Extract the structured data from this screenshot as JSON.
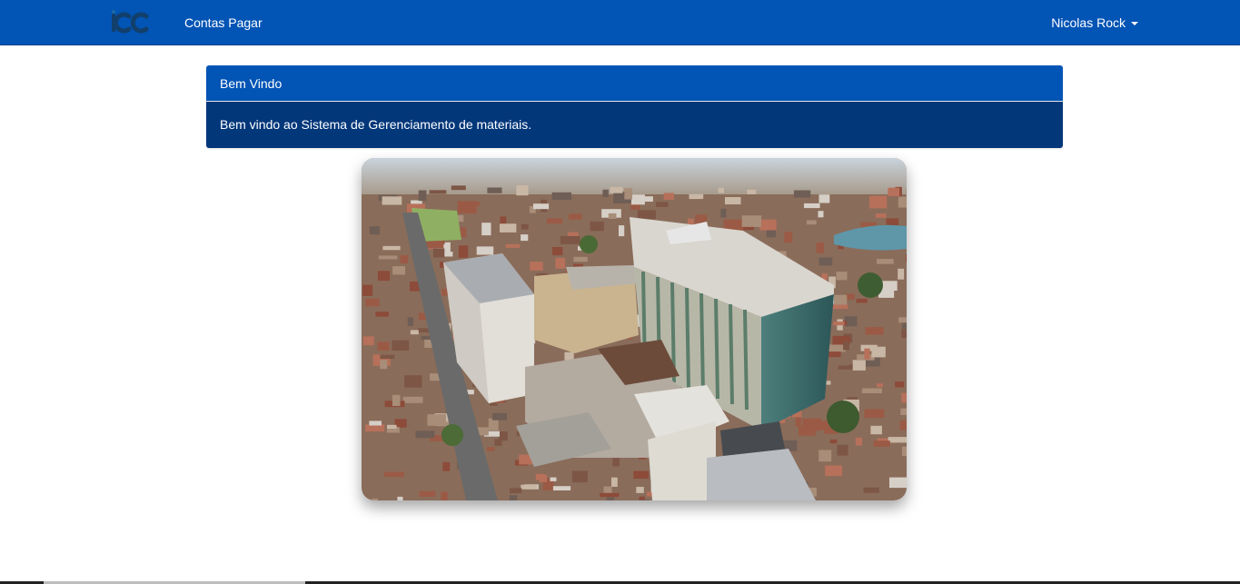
{
  "navbar": {
    "brand_logo_text": "iCC",
    "link_label": "Contas Pagar",
    "user_name": "Nicolas Rock",
    "background_color": "#0254b5"
  },
  "welcome_panel": {
    "heading": "Bem Vindo",
    "body": "Bem vindo ao Sistema de Gerenciamento de materiais.",
    "heading_color": "#0254b5",
    "body_color": "#02377a"
  },
  "hero_image": {
    "icon": "aerial-city-photo"
  },
  "icons": {
    "brand": "icc-logo-icon",
    "user_caret": "caret-down-icon"
  }
}
